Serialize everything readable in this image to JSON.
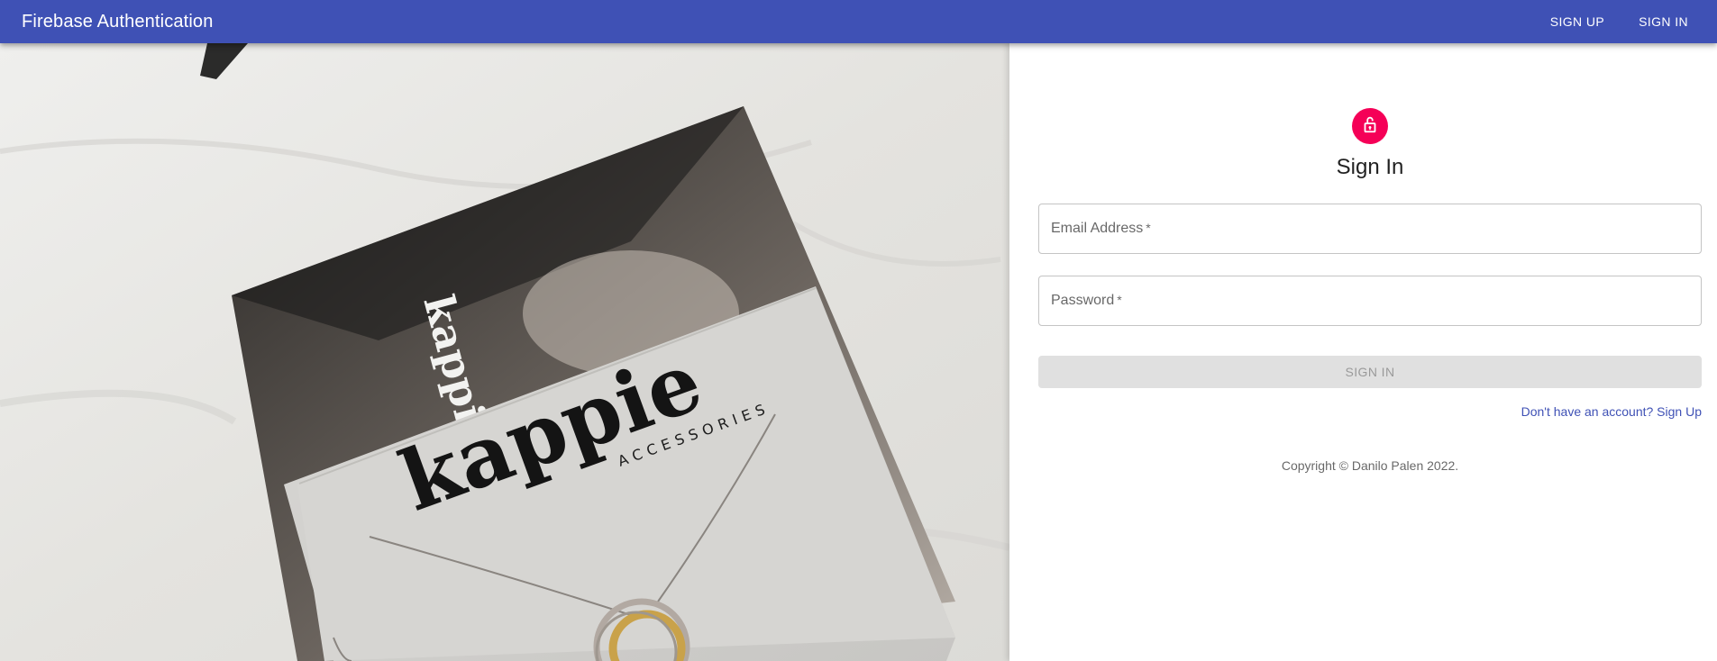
{
  "appbar": {
    "title": "Firebase Authentication",
    "nav": [
      {
        "label": "SIGN UP"
      },
      {
        "label": "SIGN IN"
      }
    ],
    "color": "#3f51b5"
  },
  "hero": {
    "brand": "kappie",
    "tagline": "ACCESSORIES"
  },
  "form": {
    "icon": "lock-icon",
    "avatar_color": "#f50057",
    "heading": "Sign In",
    "email": {
      "label": "Email Address",
      "required_mark": "*",
      "value": ""
    },
    "password": {
      "label": "Password",
      "required_mark": "*",
      "value": ""
    },
    "submit_label": "SIGN IN",
    "signup_link": "Don't have an account? Sign Up",
    "copyright": "Copyright © Danilo Palen 2022."
  }
}
